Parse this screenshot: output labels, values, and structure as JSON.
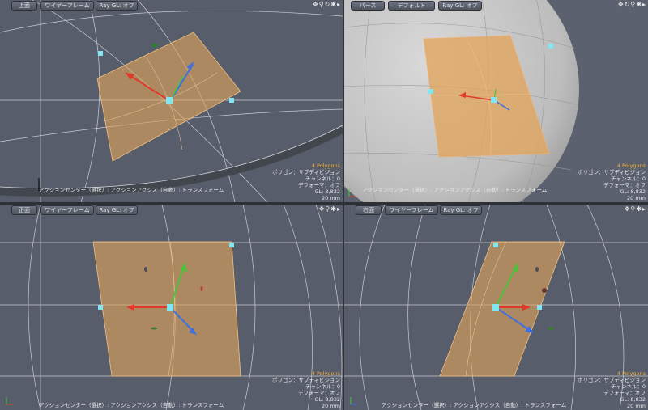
{
  "colors": {
    "viewport_bg": "#575d6a",
    "surface": "#e0a45c",
    "handle": "#7fe7f2",
    "axis_x": "#e03a2a",
    "axis_y": "#4cc23a",
    "axis_z": "#3f6fe0",
    "info_highlight": "#f0b040"
  },
  "viewports": [
    {
      "buttons": [
        "上面",
        "ワイヤーフレーム",
        "Ray GL: オフ"
      ],
      "icons": [
        "move-icon",
        "zoom-icon",
        "rotate-icon",
        "gear-icon",
        "arrow-right-icon"
      ],
      "status": "アクションセンター（選択）: アクションアクシス（自動）: トランスフォーム",
      "info": {
        "polygons": "4 Polygons",
        "polygon_type": "ポリゴン：サブディビジョン",
        "channel": "チャンネル：0",
        "deformer": "デフォーマ：オフ",
        "gl": "GL: 8,832",
        "scale": "20 mm"
      }
    },
    {
      "buttons": [
        "パース",
        "デフォルト",
        "Ray GL: オフ"
      ],
      "icons": [
        "move-icon",
        "rotate-icon",
        "zoom-icon",
        "gear-icon",
        "arrow-right-icon"
      ],
      "status": "アクションセンター（選択）: アクションアクシス（自動）: トランスフォーム",
      "info": {
        "polygons": "4 Polygons",
        "polygon_type": "ポリゴン：サブディビジョン",
        "channel": "チャンネル：0",
        "deformer": "デフォーマ：オフ",
        "gl": "GL: 8,832",
        "scale": "20 mm"
      }
    },
    {
      "buttons": [
        "正面",
        "ワイヤーフレーム",
        "Ray GL: オフ"
      ],
      "icons": [
        "move-icon",
        "zoom-icon",
        "gear-icon",
        "arrow-right-icon"
      ],
      "status": "アクションセンター（選択）: アクションアクシス（自動）: トランスフォーム",
      "info": {
        "polygons": "4 Polygons",
        "polygon_type": "ポリゴン：サブディビジョン",
        "channel": "チャンネル：0",
        "deformer": "デフォーマ：オフ",
        "gl": "GL: 8,832",
        "scale": "20 mm"
      }
    },
    {
      "buttons": [
        "右面",
        "ワイヤーフレーム",
        "Ray GL: オフ"
      ],
      "icons": [
        "move-icon",
        "zoom-icon",
        "gear-icon",
        "arrow-right-icon"
      ],
      "status": "アクションセンター（選択）: アクションアクシス（自動）: トランスフォーム",
      "info": {
        "polygons": "4 Polygons",
        "polygon_type": "ポリゴン：サブディビジョン",
        "channel": "チャンネル：0",
        "deformer": "デフォーマ：オフ",
        "gl": "GL: 8,832",
        "scale": "20 mm"
      }
    }
  ]
}
